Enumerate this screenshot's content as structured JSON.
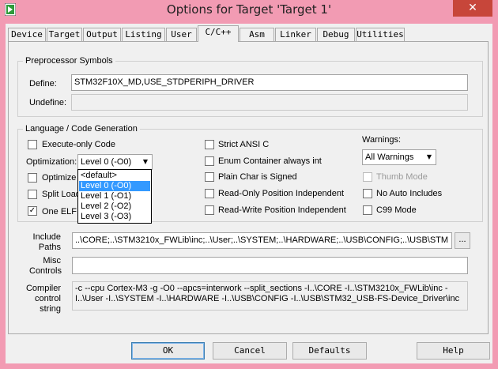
{
  "window": {
    "title": "Options for Target 'Target 1'",
    "close_symbol": "✕",
    "icon": "keil-app-icon"
  },
  "tabs": [
    "Device",
    "Target",
    "Output",
    "Listing",
    "User",
    "C/C++",
    "Asm",
    "Linker",
    "Debug",
    "Utilities"
  ],
  "active_tab": "C/C++",
  "preprocessor": {
    "title": "Preprocessor Symbols",
    "define_label": "Define:",
    "define_value": "STM32F10X_MD,USE_STDPERIPH_DRIVER",
    "undefine_label": "Undefine:",
    "undefine_value": ""
  },
  "language": {
    "title": "Language / Code Generation",
    "execute_only": "Execute-only Code",
    "optimization_label": "Optimization:",
    "optimization_value": "Level 0 (-O0)",
    "optimize_for_time": "Optimize f",
    "split_load": "Split Load",
    "one_elf": "One ELF",
    "one_elf_checked": true,
    "strict_ansi": "Strict ANSI C",
    "enum_container": "Enum Container always int",
    "plain_char": "Plain Char is Signed",
    "ropi": "Read-Only Position Independent",
    "rwpi": "Read-Write Position Independent",
    "warnings_label": "Warnings:",
    "warnings_value": "All Warnings",
    "thumb_mode": "Thumb Mode",
    "no_auto_includes": "No Auto Includes",
    "c99_mode": "C99 Mode",
    "check_mark": "✓",
    "dropdown_arrow": "▼"
  },
  "optimization_options": [
    "<default>",
    "Level 0 (-O0)",
    "Level 1 (-O1)",
    "Level 2 (-O2)",
    "Level 3 (-O3)"
  ],
  "optimization_selected": "Level 0 (-O0)",
  "include_paths": {
    "label_line1": "Include",
    "label_line2": "Paths",
    "value": "..\\CORE;..\\STM3210x_FWLib\\inc;..\\User;..\\SYSTEM;..\\HARDWARE;..\\USB\\CONFIG;..\\USB\\STM",
    "browse_label": "..."
  },
  "misc_controls": {
    "label_line1": "Misc",
    "label_line2": "Controls",
    "value": ""
  },
  "compiler_string": {
    "label_line1": "Compiler",
    "label_line2": "control",
    "label_line3": "string",
    "value": "-c --cpu Cortex-M3 -g -O0 --apcs=interwork --split_sections -I..\\CORE -I..\\STM3210x_FWLib\\inc -I..\\User -I..\\SYSTEM -I..\\HARDWARE -I..\\USB\\CONFIG -I..\\USB\\STM32_USB-FS-Device_Driver\\inc"
  },
  "buttons": {
    "ok": "OK",
    "cancel": "Cancel",
    "defaults": "Defaults",
    "help": "Help"
  }
}
